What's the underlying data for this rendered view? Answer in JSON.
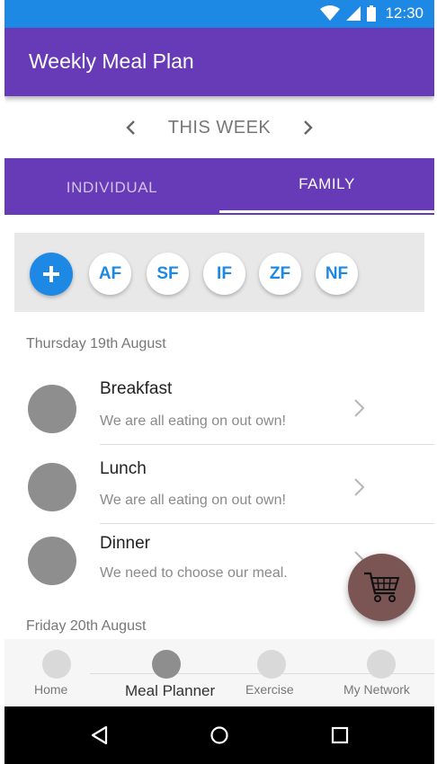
{
  "status_bar": {
    "time": "12:30",
    "icons": [
      "wifi-icon",
      "signal-icon",
      "battery-icon"
    ]
  },
  "app_bar": {
    "title": "Weekly Meal Plan",
    "color": "#673ab7"
  },
  "week_nav": {
    "label": "THIS WEEK",
    "prev_icon": "chevron-left-icon",
    "next_icon": "chevron-right-icon"
  },
  "tabs": [
    {
      "label": "INDIVIDUAL",
      "selected": false
    },
    {
      "label": "FAMILY",
      "selected": true
    }
  ],
  "members": {
    "add_icon": "plus-icon",
    "items": [
      "AF",
      "SF",
      "IF",
      "ZF",
      "NF"
    ]
  },
  "days": [
    {
      "heading": "Thursday 19th August",
      "meals": [
        {
          "title": "Breakfast",
          "subtitle": "We are all eating on out own!"
        },
        {
          "title": "Lunch",
          "subtitle": "We are all eating on out own!"
        },
        {
          "title": "Dinner",
          "subtitle": "We need to choose our meal."
        }
      ]
    },
    {
      "heading": "Friday 20th August",
      "meals": []
    }
  ],
  "fab": {
    "icon": "shopping-cart-icon",
    "color": "#7a5553"
  },
  "bottom_nav": {
    "items": [
      {
        "label": "Home",
        "active": false
      },
      {
        "label": "Meal Planner",
        "active": true
      },
      {
        "label": "Exercise",
        "active": false
      },
      {
        "label": "My Network",
        "active": false
      }
    ]
  },
  "system_nav": {
    "icons": [
      "back-icon",
      "home-circle-icon",
      "recents-icon"
    ]
  },
  "colors": {
    "primary": "#673ab7",
    "accent": "#1e88e5",
    "status_bar": "#1e88e5"
  }
}
